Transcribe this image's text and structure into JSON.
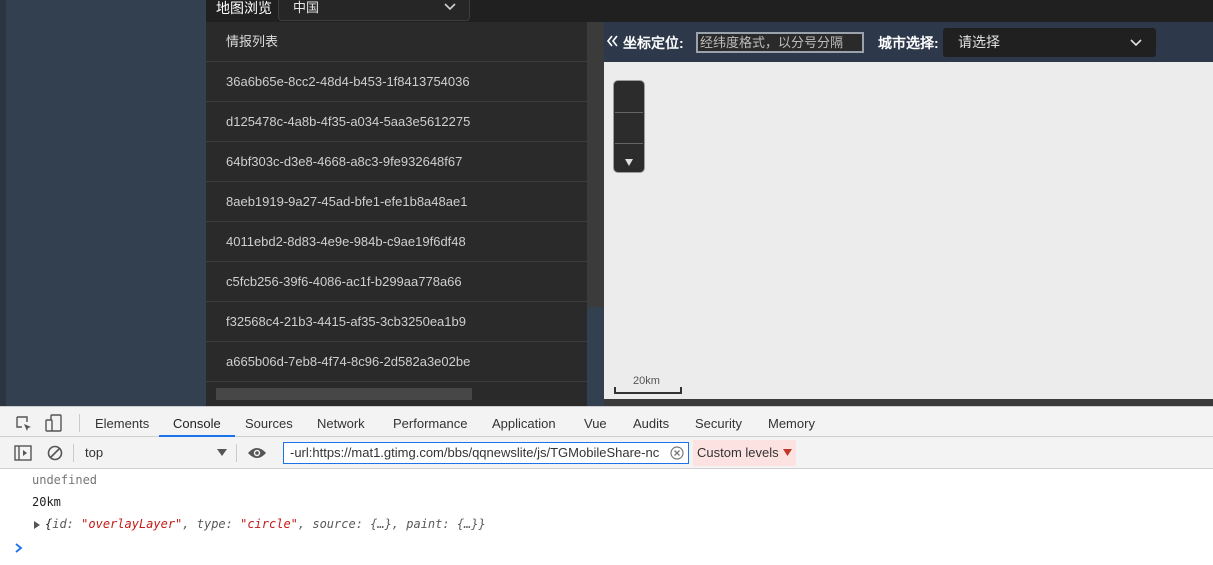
{
  "app": {
    "map_browse_label": "地图浏览",
    "country_select_value": "中国",
    "list_header": "情报列表",
    "list_items": [
      "36a6b65e-8cc2-48d4-b453-1f8413754036",
      "d125478c-4a8b-4f35-a034-5aa3e5612275",
      "64bf303c-d3e8-4668-a8c3-9fe932648f67",
      "8aeb1919-9a27-45ad-bfe1-efe1b8a48ae1",
      "4011ebd2-8d83-4e9e-984b-c9ae19f6df48",
      "c5fcb256-39f6-4086-ac1f-b299aa778a66",
      "f32568c4-21b3-4415-af35-3cb3250ea1b9",
      "a665b06d-7eb8-4f74-8c96-2d582a3e02be"
    ],
    "coord_label": "坐标定位:",
    "coord_placeholder": "经纬度格式，以分号分隔",
    "city_label": "城市选择:",
    "city_select_value": "请选择",
    "scale_text": "20km"
  },
  "devtools": {
    "tabs": [
      "Elements",
      "Console",
      "Sources",
      "Network",
      "Performance",
      "Application",
      "Vue",
      "Audits",
      "Security",
      "Memory"
    ],
    "active_tab": "Console",
    "context": "top",
    "filter_value": "-url:https://mat1.gtimg.com/bbs/qqnewslite/js/TGMobileShare-nc",
    "levels": "Custom levels",
    "console_lines": {
      "undefined": "undefined",
      "scale": "20km",
      "object": {
        "open": "{",
        "k1": "id: ",
        "v1": "\"overlayLayer\"",
        "k2": ", type: ",
        "v2": "\"circle\"",
        "rest": ", source: {…}, paint: {…}}"
      }
    }
  },
  "colors": {
    "app_bg": "#33404f",
    "panel_bg": "#2a2a2a",
    "map_bg": "#ececec",
    "devtools_accent": "#1a73e8",
    "string_red": "#c41a16",
    "levels_bg": "#fde2e2"
  },
  "icons": [
    "chevron-down-icon",
    "double-chevron-left-icon",
    "zoom-down-arrow-icon",
    "inspect-icon",
    "device-toolbar-icon",
    "sidebar-toggle-icon",
    "clear-console-icon",
    "eye-icon",
    "clear-filter-icon",
    "prompt-chevron-icon",
    "expand-arrow-icon"
  ]
}
